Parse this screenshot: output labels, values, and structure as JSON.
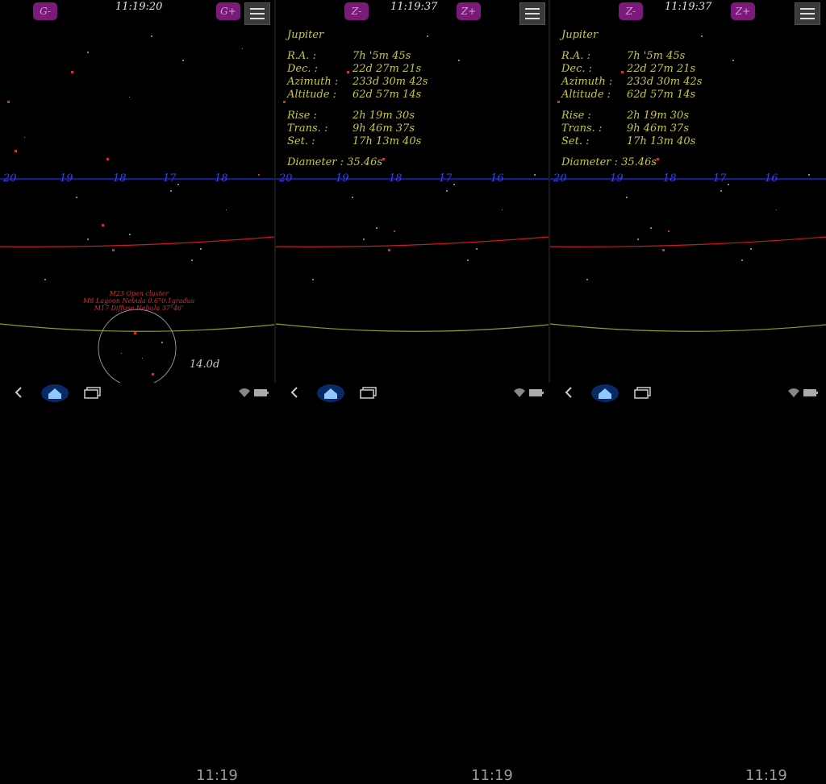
{
  "panels": [
    {
      "time": "11:19:20",
      "left_button": "G-",
      "right_button": "G+",
      "ra_ticks": [
        "20",
        "19",
        "18",
        "17",
        "18"
      ],
      "object_labels": [
        "M23 Open cluster",
        "M8 Lagoon Nebula 0.6°0.1gradus",
        "M17 Diffuse Nebula 37°46'"
      ],
      "fov": "14.0d"
    },
    {
      "time": "11:19:37",
      "left_button": "Z-",
      "right_button": "Z+",
      "ra_ticks": [
        "20",
        "19",
        "18",
        "17",
        "16"
      ]
    },
    {
      "time": "11:19:37",
      "left_button": "Z-",
      "right_button": "Z+",
      "ra_ticks": [
        "20",
        "19",
        "18",
        "17",
        "16"
      ]
    }
  ],
  "info": {
    "name": "Jupiter",
    "rows1": [
      {
        "label": "R.A. :",
        "value": "7h '5m 45s"
      },
      {
        "label": "Dec. :",
        "value": "22d 27m 21s"
      },
      {
        "label": "Azimuth :",
        "value": "233d 30m 42s"
      },
      {
        "label": "Altitude :",
        "value": "62d 57m 14s"
      }
    ],
    "rows2": [
      {
        "label": "Rise :",
        "value": "2h 19m 30s"
      },
      {
        "label": "Trans. :",
        "value": "9h 46m 37s"
      },
      {
        "label": "Set. :",
        "value": "17h 13m 40s"
      }
    ],
    "diameter": "Diameter : 35.46s"
  },
  "navbar": {
    "clock": "11:19",
    "icons": [
      "back-icon",
      "home-icon",
      "recent-apps-icon",
      "wifi-icon",
      "battery-icon"
    ]
  },
  "colors": {
    "ra_line": "#1a22cc",
    "ecliptic": "#d01818",
    "horizon": "#9a9a20",
    "info_text": "#c9c64a",
    "zoom_button": "#7a1a7a"
  }
}
